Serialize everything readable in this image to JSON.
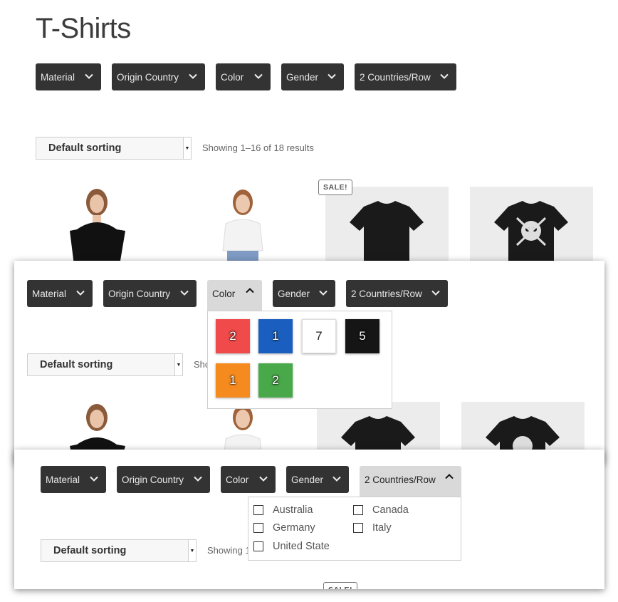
{
  "page_title": "T-Shirts",
  "filters": {
    "material": "Material",
    "origin_country": "Origin Country",
    "color": "Color",
    "gender": "Gender",
    "countries_row": "2 Countries/Row"
  },
  "sorting": {
    "selected": "Default sorting"
  },
  "result_count": "Showing 1–16 of 18 results",
  "result_count_partial_1": "Sho",
  "result_count_partial_2": "Showing 1",
  "badges": {
    "sale": "SALE!"
  },
  "color_swatches": [
    {
      "color": "#f04a4a",
      "count": "2"
    },
    {
      "color": "#1a5fbf",
      "count": "1"
    },
    {
      "color": "#ffffff",
      "count": "7"
    },
    {
      "color": "#151515",
      "count": "5"
    },
    {
      "color": "#f58a1f",
      "count": "1"
    },
    {
      "color": "#49a84a",
      "count": "2"
    }
  ],
  "countries": [
    "Australia",
    "Canada",
    "Germany",
    "Italy",
    "United State"
  ],
  "products": [
    {
      "icon": "woman-black-top-photo"
    },
    {
      "icon": "woman-white-top-photo"
    },
    {
      "icon": "black-tshirt-photo"
    },
    {
      "icon": "skull-tshirt-photo"
    }
  ]
}
